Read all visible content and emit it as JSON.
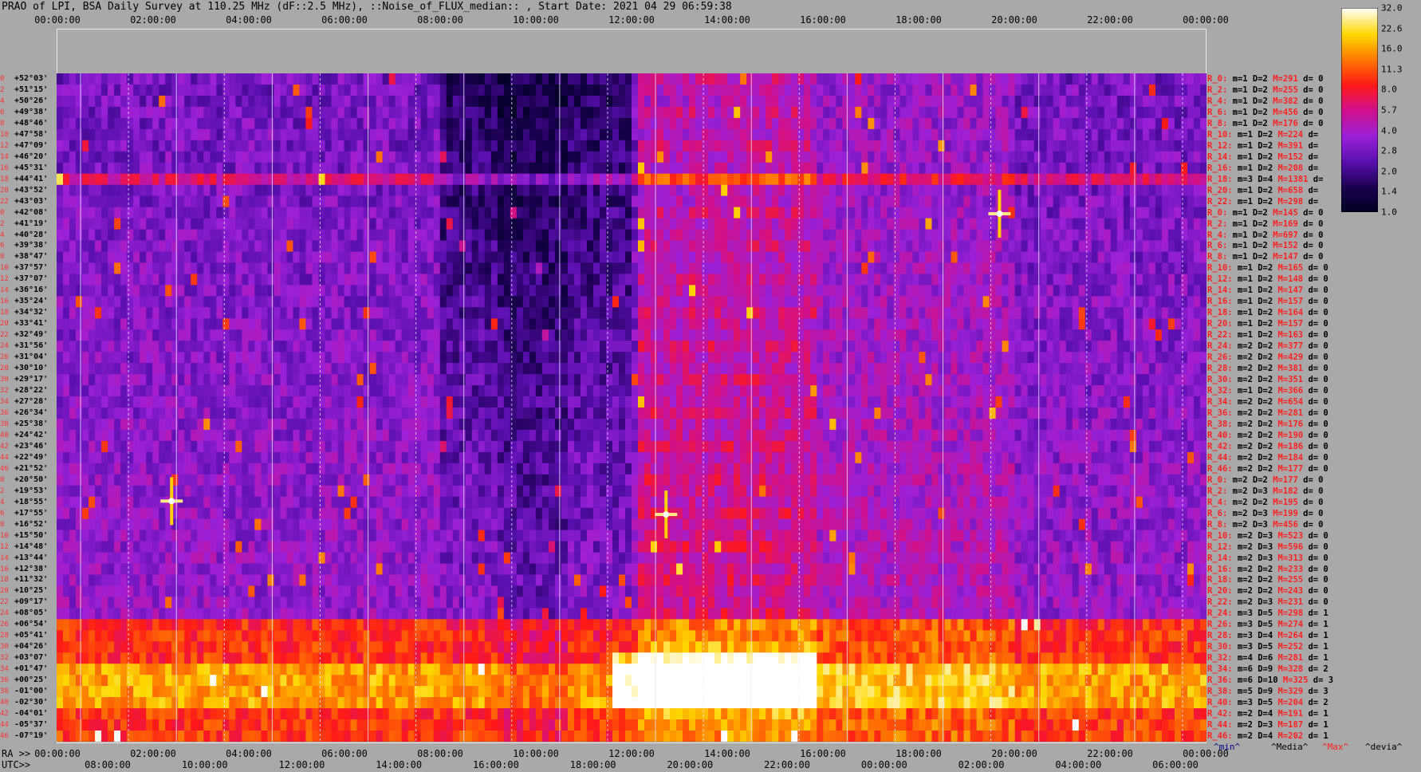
{
  "title": "PRAO of LPI, BSA Daily Survey at 110.25 MHz (dF::2.5 MHz), ::Noise_of_FLUX_median:: , Start Date: 2021 04 29 06:59:38",
  "chart_data": {
    "type": "heatmap",
    "x_top_ticks": [
      "00:00:00",
      "02:00:00",
      "04:00:00",
      "06:00:00",
      "08:00:00",
      "10:00:00",
      "12:00:00",
      "14:00:00",
      "16:00:00",
      "18:00:00",
      "20:00:00",
      "22:00:00",
      "00:00:00"
    ],
    "ra_prefix": "RA >>",
    "ra_ticks": [
      "00:00:00",
      "02:00:00",
      "04:00:00",
      "06:00:00",
      "08:00:00",
      "10:00:00",
      "12:00:00",
      "14:00:00",
      "16:00:00",
      "18:00:00",
      "20:00:00",
      "22:00:00",
      "00:00:00"
    ],
    "utc_prefix": "UTC>>",
    "utc_ticks": [
      "08:00:00",
      "10:00:00",
      "12:00:00",
      "14:00:00",
      "16:00:00",
      "18:00:00",
      "20:00:00",
      "22:00:00",
      "00:00:00",
      "02:00:00",
      "04:00:00",
      "06:00:00"
    ],
    "colorbar_ticks": [
      "32.0",
      "22.6",
      "16.0",
      "11.3",
      "8.0",
      "5.7",
      "4.0",
      "2.8",
      "2.0",
      "1.4",
      "1.0"
    ],
    "colorbar_range": [
      1.0,
      32.0
    ],
    "colorbar_scale": "log",
    "colormap": "hot-purple",
    "rows": [
      {
        "r": "R_0:",
        "m": "m=1",
        "D": "D=2",
        "M": "M=291",
        "d": "d= 0",
        "dec": "+52°03'",
        "n": "0"
      },
      {
        "r": "R_2:",
        "m": "m=1",
        "D": "D=2",
        "M": "M=255",
        "d": "d= 0",
        "dec": "+51°15'",
        "n": "2"
      },
      {
        "r": "R_4:",
        "m": "m=1",
        "D": "D=2",
        "M": "M=382",
        "d": "d= 0",
        "dec": "+50°26'",
        "n": "4"
      },
      {
        "r": "R_6:",
        "m": "m=1",
        "D": "D=2",
        "M": "M=456",
        "d": "d= 0",
        "dec": "+49°38'",
        "n": "6"
      },
      {
        "r": "R_8:",
        "m": "m=1",
        "D": "D=2",
        "M": "M=176",
        "d": "d= 0",
        "dec": "+48°46'",
        "n": "8"
      },
      {
        "r": "R_10:",
        "m": "m=1",
        "D": "D=2",
        "M": "M=224",
        "d": "d=",
        "dec": "+47°58'",
        "n": "10"
      },
      {
        "r": "R_12:",
        "m": "m=1",
        "D": "D=2",
        "M": "M=391",
        "d": "d=",
        "dec": "+47°09'",
        "n": "12"
      },
      {
        "r": "R_14:",
        "m": "m=1",
        "D": "D=2",
        "M": "M=152",
        "d": "d=",
        "dec": "+46°20'",
        "n": "14"
      },
      {
        "r": "R_16:",
        "m": "m=1",
        "D": "D=2",
        "M": "M=208",
        "d": "d=",
        "dec": "+45°31'",
        "n": "16"
      },
      {
        "r": "R_18:",
        "m": "m=3",
        "D": "D=4",
        "M": "M=1381",
        "d": "d=",
        "dec": "+44°41'",
        "n": "18"
      },
      {
        "r": "R_20:",
        "m": "m=1",
        "D": "D=2",
        "M": "M=658",
        "d": "d=",
        "dec": "+43°52'",
        "n": "20"
      },
      {
        "r": "R_22:",
        "m": "m=1",
        "D": "D=2",
        "M": "M=298",
        "d": "d=",
        "dec": "+43°03'",
        "n": "22"
      },
      {
        "r": "R_0:",
        "m": "m=1",
        "D": "D=2",
        "M": "M=145",
        "d": "d= 0",
        "dec": "+42°08'",
        "n": "0"
      },
      {
        "r": "R_2:",
        "m": "m=1",
        "D": "D=2",
        "M": "M=169",
        "d": "d= 0",
        "dec": "+41°19'",
        "n": "2"
      },
      {
        "r": "R_4:",
        "m": "m=1",
        "D": "D=2",
        "M": "M=697",
        "d": "d= 0",
        "dec": "+40°28'",
        "n": "4"
      },
      {
        "r": "R_6:",
        "m": "m=1",
        "D": "D=2",
        "M": "M=152",
        "d": "d= 0",
        "dec": "+39°38'",
        "n": "6"
      },
      {
        "r": "R_8:",
        "m": "m=1",
        "D": "D=2",
        "M": "M=147",
        "d": "d= 0",
        "dec": "+38°47'",
        "n": "8"
      },
      {
        "r": "R_10:",
        "m": "m=1",
        "D": "D=2",
        "M": "M=165",
        "d": "d= 0",
        "dec": "+37°57'",
        "n": "10"
      },
      {
        "r": "R_12:",
        "m": "m=1",
        "D": "D=2",
        "M": "M=148",
        "d": "d= 0",
        "dec": "+37°07'",
        "n": "12"
      },
      {
        "r": "R_14:",
        "m": "m=1",
        "D": "D=2",
        "M": "M=147",
        "d": "d= 0",
        "dec": "+36°16'",
        "n": "14"
      },
      {
        "r": "R_16:",
        "m": "m=1",
        "D": "D=2",
        "M": "M=157",
        "d": "d= 0",
        "dec": "+35°24'",
        "n": "16"
      },
      {
        "r": "R_18:",
        "m": "m=1",
        "D": "D=2",
        "M": "M=164",
        "d": "d= 0",
        "dec": "+34°32'",
        "n": "18"
      },
      {
        "r": "R_20:",
        "m": "m=1",
        "D": "D=2",
        "M": "M=157",
        "d": "d= 0",
        "dec": "+33°41'",
        "n": "20"
      },
      {
        "r": "R_22:",
        "m": "m=1",
        "D": "D=2",
        "M": "M=163",
        "d": "d= 0",
        "dec": "+32°49'",
        "n": "22"
      },
      {
        "r": "R_24:",
        "m": "m=2",
        "D": "D=2",
        "M": "M=377",
        "d": "d= 0",
        "dec": "+31°56'",
        "n": "24"
      },
      {
        "r": "R_26:",
        "m": "m=2",
        "D": "D=2",
        "M": "M=429",
        "d": "d= 0",
        "dec": "+31°04'",
        "n": "26"
      },
      {
        "r": "R_28:",
        "m": "m=2",
        "D": "D=2",
        "M": "M=381",
        "d": "d= 0",
        "dec": "+30°10'",
        "n": "28"
      },
      {
        "r": "R_30:",
        "m": "m=2",
        "D": "D=2",
        "M": "M=351",
        "d": "d= 0",
        "dec": "+29°17'",
        "n": "30"
      },
      {
        "r": "R_32:",
        "m": "m=1",
        "D": "D=2",
        "M": "M=366",
        "d": "d= 0",
        "dec": "+28°22'",
        "n": "32"
      },
      {
        "r": "R_34:",
        "m": "m=2",
        "D": "D=2",
        "M": "M=654",
        "d": "d= 0",
        "dec": "+27°28'",
        "n": "34"
      },
      {
        "r": "R_36:",
        "m": "m=2",
        "D": "D=2",
        "M": "M=281",
        "d": "d= 0",
        "dec": "+26°34'",
        "n": "36"
      },
      {
        "r": "R_38:",
        "m": "m=2",
        "D": "D=2",
        "M": "M=176",
        "d": "d= 0",
        "dec": "+25°38'",
        "n": "38"
      },
      {
        "r": "R_40:",
        "m": "m=2",
        "D": "D=2",
        "M": "M=190",
        "d": "d= 0",
        "dec": "+24°42'",
        "n": "40"
      },
      {
        "r": "R_42:",
        "m": "m=2",
        "D": "D=2",
        "M": "M=186",
        "d": "d= 0",
        "dec": "+23°46'",
        "n": "42"
      },
      {
        "r": "R_44:",
        "m": "m=2",
        "D": "D=2",
        "M": "M=184",
        "d": "d= 0",
        "dec": "+22°49'",
        "n": "44"
      },
      {
        "r": "R_46:",
        "m": "m=2",
        "D": "D=2",
        "M": "M=177",
        "d": "d= 0",
        "dec": "+21°52'",
        "n": "46"
      },
      {
        "r": "R_0:",
        "m": "m=2",
        "D": "D=2",
        "M": "M=177",
        "d": "d= 0",
        "dec": "+20°50'",
        "n": "0"
      },
      {
        "r": "R_2:",
        "m": "m=2",
        "D": "D=3",
        "M": "M=182",
        "d": "d= 0",
        "dec": "+19°53'",
        "n": "2"
      },
      {
        "r": "R_4:",
        "m": "m=2",
        "D": "D=2",
        "M": "M=195",
        "d": "d= 0",
        "dec": "+18°55'",
        "n": "4"
      },
      {
        "r": "R_6:",
        "m": "m=2",
        "D": "D=3",
        "M": "M=199",
        "d": "d= 0",
        "dec": "+17°55'",
        "n": "6"
      },
      {
        "r": "R_8:",
        "m": "m=2",
        "D": "D=3",
        "M": "M=456",
        "d": "d= 0",
        "dec": "+16°52'",
        "n": "8"
      },
      {
        "r": "R_10:",
        "m": "m=2",
        "D": "D=3",
        "M": "M=523",
        "d": "d= 0",
        "dec": "+15°50'",
        "n": "10"
      },
      {
        "r": "R_12:",
        "m": "m=2",
        "D": "D=3",
        "M": "M=596",
        "d": "d= 0",
        "dec": "+14°48'",
        "n": "12"
      },
      {
        "r": "R_14:",
        "m": "m=2",
        "D": "D=3",
        "M": "M=313",
        "d": "d= 0",
        "dec": "+13°44'",
        "n": "14"
      },
      {
        "r": "R_16:",
        "m": "m=2",
        "D": "D=2",
        "M": "M=233",
        "d": "d= 0",
        "dec": "+12°38'",
        "n": "16"
      },
      {
        "r": "R_18:",
        "m": "m=2",
        "D": "D=2",
        "M": "M=255",
        "d": "d= 0",
        "dec": "+11°32'",
        "n": "18"
      },
      {
        "r": "R_20:",
        "m": "m=2",
        "D": "D=2",
        "M": "M=243",
        "d": "d= 0",
        "dec": "+10°25'",
        "n": "20"
      },
      {
        "r": "R_22:",
        "m": "m=2",
        "D": "D=3",
        "M": "M=231",
        "d": "d= 0",
        "dec": "+09°17'",
        "n": "22"
      },
      {
        "r": "R_24:",
        "m": "m=3",
        "D": "D=5",
        "M": "M=298",
        "d": "d= 1",
        "dec": "+08°05'",
        "n": "24"
      },
      {
        "r": "R_26:",
        "m": "m=3",
        "D": "D=5",
        "M": "M=274",
        "d": "d= 1",
        "dec": "+06°54'",
        "n": "26"
      },
      {
        "r": "R_28:",
        "m": "m=3",
        "D": "D=4",
        "M": "M=264",
        "d": "d= 1",
        "dec": "+05°41'",
        "n": "28"
      },
      {
        "r": "R_30:",
        "m": "m=3",
        "D": "D=5",
        "M": "M=252",
        "d": "d= 1",
        "dec": "+04°26'",
        "n": "30"
      },
      {
        "r": "R_32:",
        "m": "m=4",
        "D": "D=6",
        "M": "M=281",
        "d": "d= 1",
        "dec": "+03°07'",
        "n": "32"
      },
      {
        "r": "R_34:",
        "m": "m=6",
        "D": "D=9",
        "M": "M=328",
        "d": "d= 2",
        "dec": "+01°47'",
        "n": "34"
      },
      {
        "r": "R_36:",
        "m": "m=6",
        "D": "D=10",
        "M": "M=325",
        "d": "d= 3",
        "dec": "+00°25'",
        "n": "36"
      },
      {
        "r": "R_38:",
        "m": "m=5",
        "D": "D=9",
        "M": "M=329",
        "d": "d= 3",
        "dec": "-01°00'",
        "n": "38"
      },
      {
        "r": "R_40:",
        "m": "m=3",
        "D": "D=5",
        "M": "M=204",
        "d": "d= 2",
        "dec": "-02°30'",
        "n": "40"
      },
      {
        "r": "R_42:",
        "m": "m=2",
        "D": "D=4",
        "M": "M=191",
        "d": "d= 1",
        "dec": "-04°01'",
        "n": "42"
      },
      {
        "r": "R_44:",
        "m": "m=2",
        "D": "D=3",
        "M": "M=187",
        "d": "d= 1",
        "dec": "-05°37'",
        "n": "44"
      },
      {
        "r": "R_46:",
        "m": "m=2",
        "D": "D=4",
        "M": "M=202",
        "d": "d= 1",
        "dec": "-07°19'",
        "n": "46"
      }
    ]
  },
  "legend": {
    "min": "^min^",
    "median": "^Media^",
    "max": "^Max^",
    "devia": "^devia^"
  },
  "colors": {
    "axis_text": "#000000",
    "red_text": "#ff2020",
    "background": "#a9a9a9",
    "legend_min": "#00008b",
    "legend_median": "#000000",
    "legend_max": "#ff2020",
    "legend_devia": "#000000"
  }
}
